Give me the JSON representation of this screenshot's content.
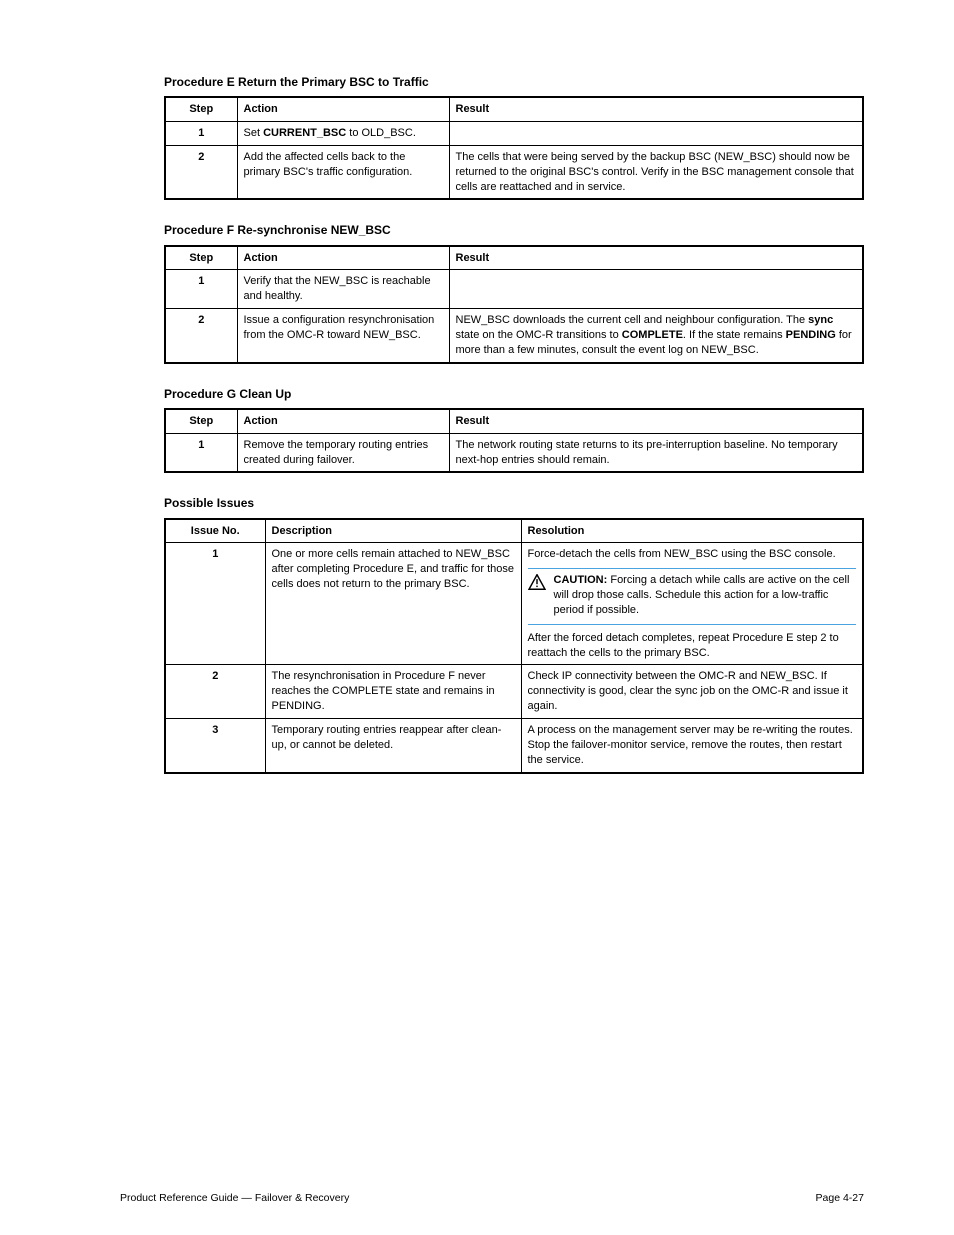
{
  "sections": [
    {
      "title": "Procedure E  Return the Primary BSC to Traffic",
      "headers": [
        "Step",
        "Action",
        "Result"
      ],
      "rows": [
        {
          "step": "1",
          "action": "Set <b>CURRENT_BSC</b> to OLD_BSC.",
          "result": ""
        },
        {
          "step": "2",
          "action": "Add the affected cells back to the primary BSC's traffic configuration.",
          "result": "The cells that were being served by the backup BSC (NEW_BSC) should now be returned to the original BSC's control. Verify in the BSC management console that cells are reattached and in service."
        }
      ]
    },
    {
      "title": "Procedure F  Re-synchronise NEW_BSC",
      "headers": [
        "Step",
        "Action",
        "Result"
      ],
      "rows": [
        {
          "step": "1",
          "action": "Verify that the NEW_BSC is reachable and healthy.",
          "result": ""
        },
        {
          "step": "2",
          "action": "Issue a configuration resynchronisation from the OMC-R toward NEW_BSC.",
          "result": "NEW_BSC downloads the current cell and neighbour configuration. The <b>sync</b> state on the OMC-R transitions to <b>COMPLETE</b>. If the state remains <b>PENDING</b> for more than a few minutes, consult the event log on NEW_BSC."
        }
      ]
    },
    {
      "title": "Procedure G  Clean Up",
      "headers": [
        "Step",
        "Action",
        "Result"
      ],
      "rows": [
        {
          "step": "1",
          "action": "Remove the temporary routing entries created during failover.",
          "result": "The network routing state returns to its pre-interruption baseline. No temporary next-hop entries should remain."
        }
      ]
    }
  ],
  "issues": {
    "title": "Possible Issues",
    "headers": [
      "Issue No.",
      "Description",
      "Resolution"
    ],
    "rows": [
      {
        "no": "1",
        "desc": "One or more cells remain attached to NEW_BSC after completing Procedure E, and traffic for those cells does not return to the primary BSC.",
        "resolution_intro": "Force-detach the cells from NEW_BSC using the BSC console.",
        "caution_title": "CAUTION:",
        "caution_body": "Forcing a detach while calls are active on the cell will drop those calls. Schedule this action for a low-traffic period if possible.",
        "resolution_outro": "After the forced detach completes, repeat Procedure E step 2 to reattach the cells to the primary BSC."
      },
      {
        "no": "2",
        "desc": "The resynchronisation in Procedure F never reaches the COMPLETE state and remains in PENDING.",
        "resolution": "Check IP connectivity between the OMC-R and NEW_BSC. If connectivity is good, clear the sync job on the OMC-R and issue it again."
      },
      {
        "no": "3",
        "desc": "Temporary routing entries reappear after clean-up, or cannot be deleted.",
        "resolution": "A process on the management server may be re-writing the routes. Stop the failover-monitor service, remove the routes, then restart the service."
      }
    ]
  },
  "footer": {
    "left": "Product Reference Guide — Failover & Recovery",
    "right": "Page 4-27"
  }
}
